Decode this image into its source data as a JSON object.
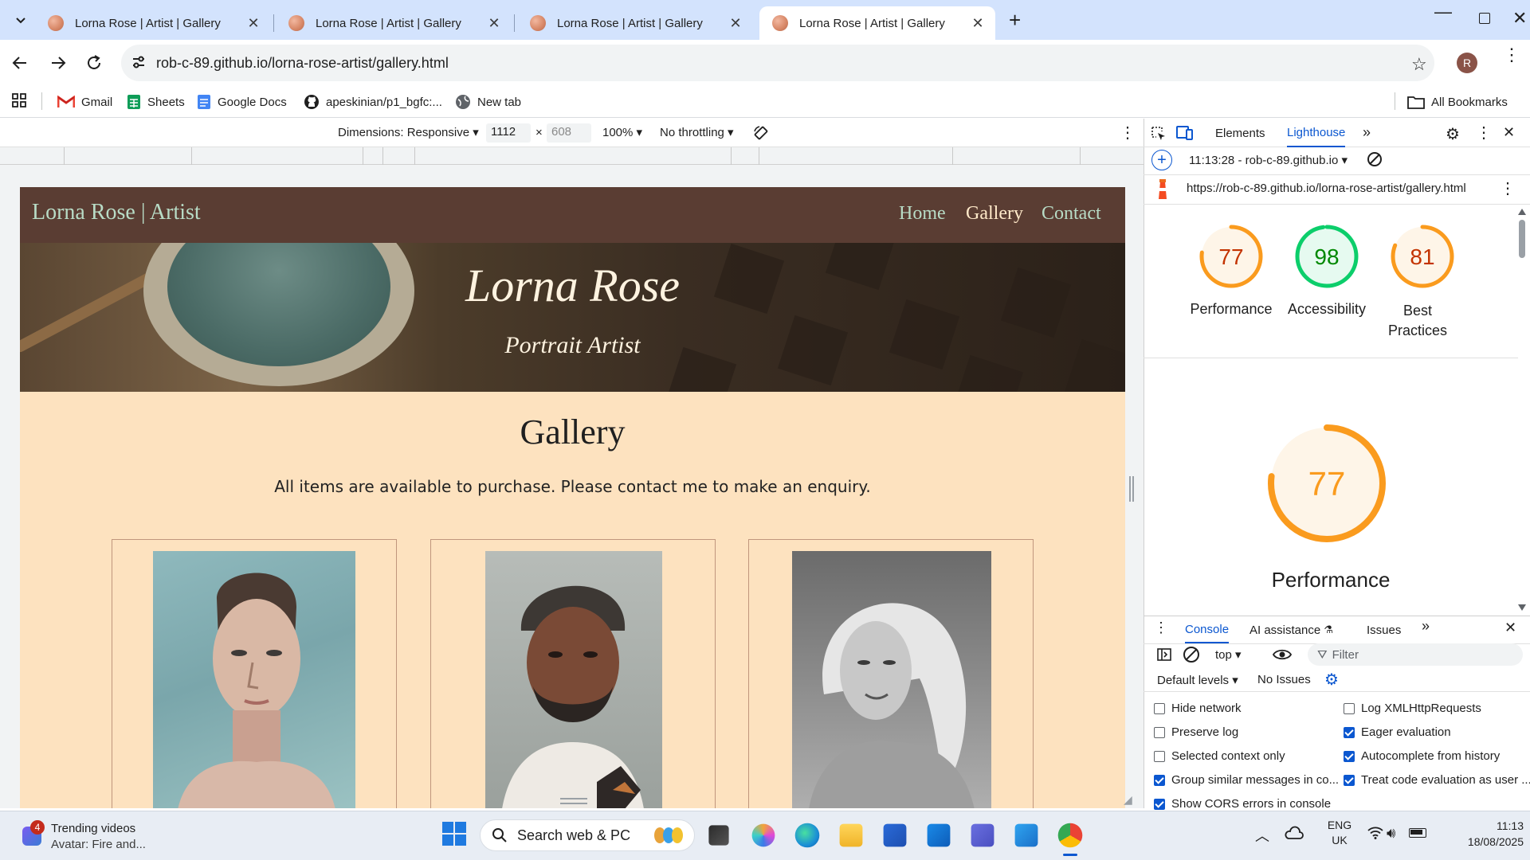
{
  "browser": {
    "tabs": [
      {
        "title": "Lorna Rose | Artist | Gallery",
        "active": false
      },
      {
        "title": "Lorna Rose | Artist | Gallery",
        "active": false
      },
      {
        "title": "Lorna Rose | Artist | Gallery",
        "active": false
      },
      {
        "title": "Lorna Rose | Artist | Gallery",
        "active": true
      }
    ],
    "url": "rob-c-89.github.io/lorna-rose-artist/gallery.html",
    "profile_initial": "R",
    "bookmarks": [
      {
        "label": "Gmail",
        "icon": "gmail-icon"
      },
      {
        "label": "Sheets",
        "icon": "sheets-icon"
      },
      {
        "label": "Google Docs",
        "icon": "docs-icon"
      },
      {
        "label": "apeskinian/p1_bgfc:...",
        "icon": "github-icon"
      },
      {
        "label": "New tab",
        "icon": "globe-icon"
      }
    ],
    "all_bookmarks": "All Bookmarks"
  },
  "emulation": {
    "dimensions": "Dimensions: Responsive",
    "width": "1112",
    "height": "608",
    "zoom": "100%",
    "throttling": "No throttling"
  },
  "site": {
    "logo": "Lorna Rose | Artist",
    "nav": [
      {
        "label": "Home",
        "active": false
      },
      {
        "label": "Gallery",
        "active": true
      },
      {
        "label": "Contact",
        "active": false
      }
    ],
    "hero_title": "Lorna Rose",
    "hero_subtitle": "Portrait Artist",
    "heading": "Gallery",
    "intro": "All items are available to purchase. Please contact me to make an enquiry."
  },
  "devtools": {
    "tabs": [
      "Elements",
      "Lighthouse"
    ],
    "active_tab": "Lighthouse",
    "report_time": "11:13:28 - rob-c-89.github.io",
    "report_url": "https://rob-c-89.github.io/lorna-rose-artist/gallery.html",
    "scores": [
      {
        "label": "Performance",
        "value": 77,
        "color": "#fa9b1e"
      },
      {
        "label": "Accessibility",
        "value": 98,
        "color": "#0cce6b"
      },
      {
        "label": "Best Practices",
        "value": 81,
        "color": "#fa9b1e"
      }
    ],
    "big_score": {
      "label": "Performance",
      "value": 77,
      "color": "#fa9b1e"
    },
    "drawer_tabs": [
      "Console",
      "AI assistance",
      "Issues"
    ],
    "context": "top",
    "filter_placeholder": "Filter",
    "levels": "Default levels",
    "issues": "No Issues",
    "settings_left": [
      {
        "label": "Hide network",
        "checked": false
      },
      {
        "label": "Preserve log",
        "checked": false
      },
      {
        "label": "Selected context only",
        "checked": false
      },
      {
        "label": "Group similar messages in co...",
        "checked": true
      },
      {
        "label": "Show CORS errors in console",
        "checked": true
      }
    ],
    "settings_right": [
      {
        "label": "Log XMLHttpRequests",
        "checked": false
      },
      {
        "label": "Eager evaluation",
        "checked": true
      },
      {
        "label": "Autocomplete from history",
        "checked": true
      },
      {
        "label": "Treat code evaluation as user ...",
        "checked": true
      }
    ]
  },
  "taskbar": {
    "widget_badge": "4",
    "widget_title": "Trending videos",
    "widget_sub": "Avatar: Fire and...",
    "search_placeholder": "Search web & PC",
    "lang": "ENG",
    "region": "UK",
    "time": "11:13",
    "date": "18/08/2025"
  }
}
